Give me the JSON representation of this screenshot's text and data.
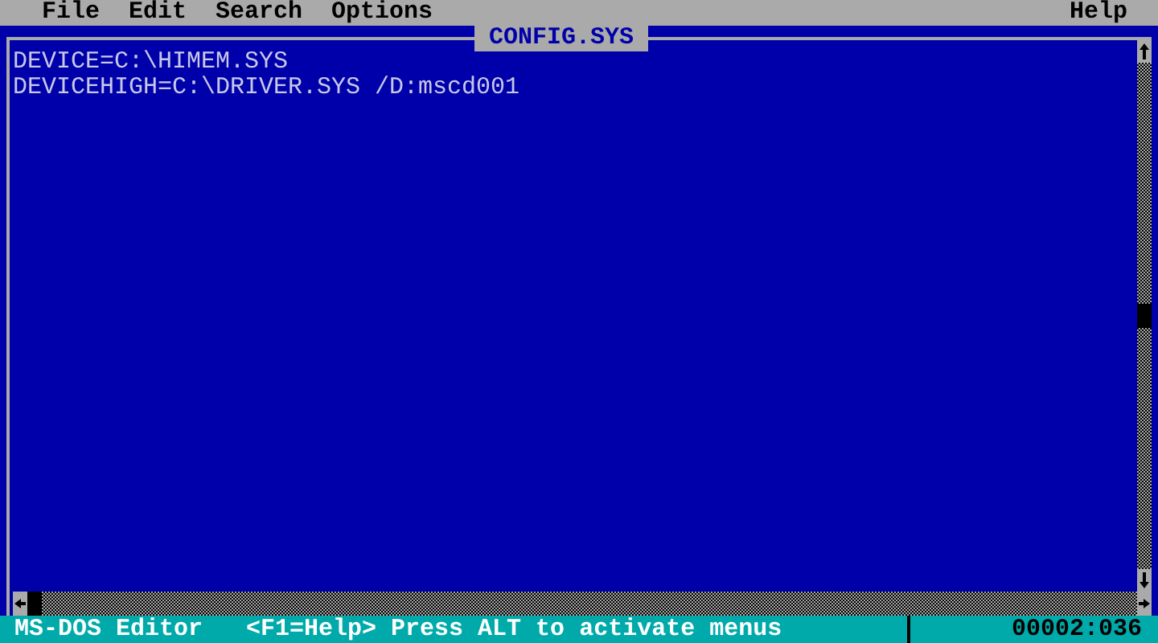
{
  "menu_bar": {
    "items": [
      {
        "label": "File"
      },
      {
        "label": "Edit"
      },
      {
        "label": "Search"
      },
      {
        "label": "Options"
      }
    ],
    "help": "Help"
  },
  "editor": {
    "title": "CONFIG.SYS",
    "lines": [
      "DEVICE=C:\\HIMEM.SYS",
      "DEVICEHIGH=C:\\DRIVER.SYS /D:mscd001"
    ]
  },
  "status_bar": {
    "app": "MS-DOS Editor",
    "hint": "<F1=Help> Press ALT to activate menus",
    "position": "00002:036"
  }
}
